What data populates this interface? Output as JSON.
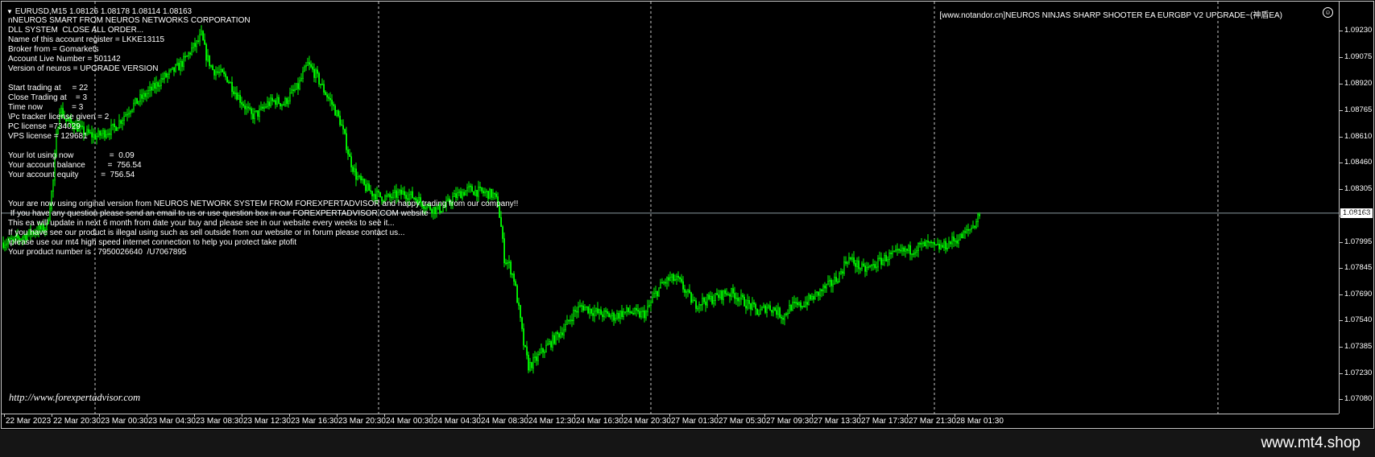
{
  "header": {
    "symbol_line": "EURUSD,M15  1.08126 1.08178 1.08114 1.08163",
    "ea_banner": "[www.notandor.cn]NEUROS NINJAS SHARP SHOOTER EA EURGBP V2 UPGRADE~(神盾EA)"
  },
  "info_lines": [
    "nNEUROS SMART FROM NEUROS NETWORKS CORPORATION",
    "DLL SYSTEM  CLOSE ALL ORDER...",
    "Name of this account register = LKKE13115",
    "Broker from = Gomarkets",
    "Account Live Number = 501142",
    "Version of neuros = UPGRADE VERSION",
    "",
    "Start trading at     = 22",
    "Close Trading at    = 3",
    "Time now             = 3",
    "\\Pc tracker license given = 2",
    "PC license =734029",
    "VPS license = 129681",
    "",
    "Your lot using now                =  0.09",
    "Your account balance          =  756.54",
    "Your account equity          =  756.54",
    "",
    "",
    "Your are now using original version from NEUROS NETWORK SYSTEM FROM FOREXPERTADVISOR and happy trading from our company!!",
    " If you have any question please send an email to us or use question box in our FOREXPERTADVISOR.COM website",
    "This ea will update in next 6 month from date your buy and please see in our website every weeks to see it...",
    "If you have see our product is illegal using such as sell outside from our website or in forum please contact us...",
    "\\please use our mt4 high speed internet connection to help you protect take ptofit",
    "Your product number is : 7950026640  /U7067895"
  ],
  "watermark": "http://www.forexpertadvisor.com",
  "footer_text": "www.mt4.shop",
  "current_price": "1.08163",
  "price_axis": [
    "1.09230",
    "1.09075",
    "1.08920",
    "1.08765",
    "1.08610",
    "1.08460",
    "1.08305",
    "1.08150",
    "1.07995",
    "1.07845",
    "1.07690",
    "1.07540",
    "1.07385",
    "1.07230",
    "1.07080"
  ],
  "time_axis": [
    "22 Mar 2023",
    "22 Mar 20:30",
    "23 Mar 00:30",
    "23 Mar 04:30",
    "23 Mar 08:30",
    "23 Mar 12:30",
    "23 Mar 16:30",
    "23 Mar 20:30",
    "24 Mar 00:30",
    "24 Mar 04:30",
    "24 Mar 08:30",
    "24 Mar 12:30",
    "24 Mar 16:30",
    "24 Mar 20:30",
    "27 Mar 01:30",
    "27 Mar 05:30",
    "27 Mar 09:30",
    "27 Mar 13:30",
    "27 Mar 17:30",
    "27 Mar 21:30",
    "28 Mar 01:30"
  ],
  "colors": {
    "background": "#000000",
    "candle": "#00ff00",
    "text": "#ffffff",
    "grid": "#c8c8c8"
  },
  "icons": {
    "collapse": "triangle-down-icon",
    "ea_status": "smiley-icon"
  },
  "chart_data": {
    "type": "candlestick",
    "symbol": "EURUSD",
    "timeframe": "M15",
    "ylim": [
      1.0705,
      1.0935
    ],
    "close_path": [
      [
        0,
        1.0799
      ],
      [
        14,
        1.08
      ],
      [
        28,
        1.0803
      ],
      [
        42,
        1.0806
      ],
      [
        56,
        1.0808
      ],
      [
        64,
        1.0835
      ],
      [
        68,
        1.086
      ],
      [
        72,
        1.0878
      ],
      [
        80,
        1.087
      ],
      [
        90,
        1.0868
      ],
      [
        100,
        1.0864
      ],
      [
        110,
        1.0862
      ],
      [
        118,
        1.0861
      ],
      [
        126,
        1.0863
      ],
      [
        140,
        1.0866
      ],
      [
        150,
        1.0872
      ],
      [
        160,
        1.0878
      ],
      [
        170,
        1.0882
      ],
      [
        180,
        1.0886
      ],
      [
        190,
        1.089
      ],
      [
        200,
        1.0895
      ],
      [
        210,
        1.0898
      ],
      [
        220,
        1.0902
      ],
      [
        228,
        1.0906
      ],
      [
        236,
        1.0912
      ],
      [
        242,
        1.0915
      ],
      [
        248,
        1.092
      ],
      [
        254,
        1.0908
      ],
      [
        262,
        1.09
      ],
      [
        270,
        1.0898
      ],
      [
        280,
        1.0895
      ],
      [
        290,
        1.0887
      ],
      [
        300,
        1.088
      ],
      [
        310,
        1.0873
      ],
      [
        320,
        1.0875
      ],
      [
        330,
        1.088
      ],
      [
        340,
        1.0882
      ],
      [
        350,
        1.088
      ],
      [
        360,
        1.0886
      ],
      [
        368,
        1.089
      ],
      [
        374,
        1.0897
      ],
      [
        380,
        1.0903
      ],
      [
        390,
        1.0897
      ],
      [
        400,
        1.0888
      ],
      [
        410,
        1.088
      ],
      [
        420,
        1.087
      ],
      [
        426,
        1.086
      ],
      [
        432,
        1.0848
      ],
      [
        440,
        1.0838
      ],
      [
        450,
        1.0832
      ],
      [
        460,
        1.0828
      ],
      [
        470,
        1.0826
      ],
      [
        480,
        1.0825
      ],
      [
        490,
        1.0827
      ],
      [
        500,
        1.0828
      ],
      [
        510,
        1.0826
      ],
      [
        520,
        1.0823
      ],
      [
        530,
        1.082
      ],
      [
        540,
        1.0818
      ],
      [
        550,
        1.082
      ],
      [
        560,
        1.0825
      ],
      [
        570,
        1.0828
      ],
      [
        580,
        1.083
      ],
      [
        590,
        1.0829
      ],
      [
        600,
        1.0828
      ],
      [
        610,
        1.0827
      ],
      [
        616,
        1.0822
      ],
      [
        620,
        1.0808
      ],
      [
        624,
        1.079
      ],
      [
        630,
        1.0786
      ],
      [
        636,
        1.0778
      ],
      [
        642,
        1.076
      ],
      [
        648,
        1.074
      ],
      [
        654,
        1.0727
      ],
      [
        662,
        1.073
      ],
      [
        670,
        1.0735
      ],
      [
        680,
        1.074
      ],
      [
        690,
        1.0745
      ],
      [
        700,
        1.075
      ],
      [
        710,
        1.0758
      ],
      [
        720,
        1.0762
      ],
      [
        730,
        1.076
      ],
      [
        740,
        1.0758
      ],
      [
        750,
        1.0757
      ],
      [
        760,
        1.0756
      ],
      [
        770,
        1.0758
      ],
      [
        780,
        1.0759
      ],
      [
        790,
        1.0757
      ],
      [
        800,
        1.0758
      ],
      [
        810,
        1.0768
      ],
      [
        820,
        1.0775
      ],
      [
        830,
        1.0778
      ],
      [
        840,
        1.0777
      ],
      [
        850,
        1.077
      ],
      [
        860,
        1.0763
      ],
      [
        870,
        1.0765
      ],
      [
        880,
        1.0766
      ],
      [
        890,
        1.0768
      ],
      [
        900,
        1.077
      ],
      [
        910,
        1.0769
      ],
      [
        920,
        1.0765
      ],
      [
        930,
        1.0762
      ],
      [
        940,
        1.0758
      ],
      [
        950,
        1.0762
      ],
      [
        960,
        1.076
      ],
      [
        970,
        1.0756
      ],
      [
        980,
        1.0762
      ],
      [
        990,
        1.0762
      ],
      [
        1000,
        1.0765
      ],
      [
        1010,
        1.0768
      ],
      [
        1020,
        1.0772
      ],
      [
        1030,
        1.0775
      ],
      [
        1040,
        1.078
      ],
      [
        1050,
        1.079
      ],
      [
        1060,
        1.0787
      ],
      [
        1070,
        1.0783
      ],
      [
        1080,
        1.0785
      ],
      [
        1090,
        1.0788
      ],
      [
        1100,
        1.0791
      ],
      [
        1110,
        1.0792
      ],
      [
        1120,
        1.0794
      ],
      [
        1130,
        1.0795
      ],
      [
        1140,
        1.0797
      ],
      [
        1150,
        1.0798
      ],
      [
        1160,
        1.0796
      ],
      [
        1170,
        1.0797
      ],
      [
        1180,
        1.08
      ],
      [
        1190,
        1.0802
      ],
      [
        1200,
        1.0806
      ],
      [
        1208,
        1.081
      ],
      [
        1214,
        1.0816
      ]
    ]
  }
}
